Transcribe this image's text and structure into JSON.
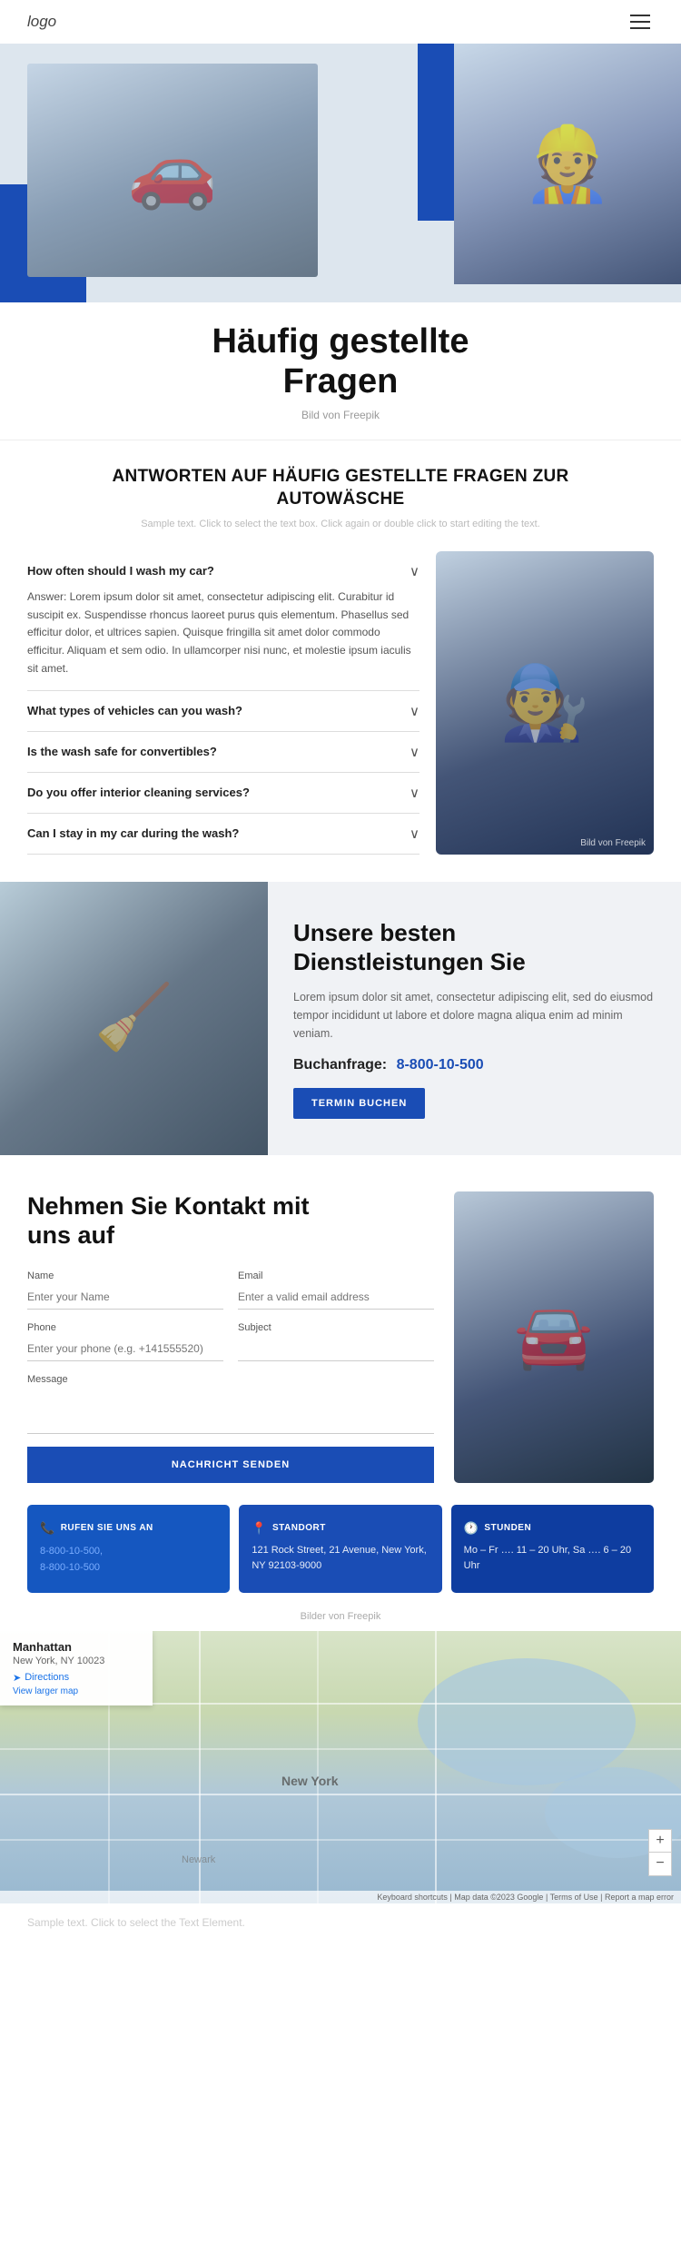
{
  "header": {
    "logo": "logo",
    "menu_icon": "☰"
  },
  "hero": {
    "title_line1": "Häufig gestellte",
    "title_line2": "Fragen",
    "credit": "Bild von Freepik"
  },
  "faq_section": {
    "title": "ANTWORTEN AUF HÄUFIG GESTELLTE FRAGEN ZUR AUTOWÄSCHE",
    "subtitle": "Sample text. Click to select the text box. Click again or double click to start editing the text.",
    "items": [
      {
        "question": "How often should I wash my car?",
        "answer": "Answer: Lorem ipsum dolor sit amet, consectetur adipiscing elit. Curabitur id suscipit ex. Suspendisse rhoncus laoreet purus quis elementum. Phasellus sed efficitur dolor, et ultrices sapien. Quisque fringilla sit amet dolor commodo efficitur. Aliquam et sem odio. In ullamcorper nisi nunc, et molestie ipsum iaculis sit amet.",
        "expanded": true
      },
      {
        "question": "What types of vehicles can you wash?",
        "answer": "",
        "expanded": false
      },
      {
        "question": "Is the wash safe for convertibles?",
        "answer": "",
        "expanded": false
      },
      {
        "question": "Do you offer interior cleaning services?",
        "answer": "",
        "expanded": false
      },
      {
        "question": "Can I stay in my car during the wash?",
        "answer": "",
        "expanded": false
      }
    ],
    "image_credit": "Bild von Freepik"
  },
  "services": {
    "title_line1": "Unsere besten",
    "title_line2": "Dienstleistungen Sie",
    "description": "Lorem ipsum dolor sit amet, consectetur adipiscing elit, sed do eiusmod tempor incididunt ut labore et dolore magna aliqua enim ad minim veniam.",
    "phone_label": "Buchanfrage:",
    "phone_number": "8-800-10-500",
    "button_label": "TERMIN BUCHEN"
  },
  "contact": {
    "title_line1": "Nehmen Sie Kontakt mit",
    "title_line2": "uns auf",
    "form": {
      "name_label": "Name",
      "name_placeholder": "Enter your Name",
      "email_label": "Email",
      "email_placeholder": "Enter a valid email address",
      "phone_label": "Phone",
      "phone_placeholder": "Enter your phone (e.g. +141555520)",
      "subject_label": "Subject",
      "subject_placeholder": "",
      "message_label": "Message",
      "message_placeholder": "",
      "submit_label": "NACHRICHT SENDEN"
    }
  },
  "info_cards": [
    {
      "icon": "📞",
      "title": "RUFEN SIE UNS AN",
      "lines": [
        "8-800-10-500,",
        "8-800-10-500"
      ]
    },
    {
      "icon": "📍",
      "title": "STANDORT",
      "lines": [
        "121 Rock Street, 21 Avenue, New York, NY 92103-9000"
      ]
    },
    {
      "icon": "🕐",
      "title": "STUNDEN",
      "lines": [
        "Mo – Fr …. 11 – 20 Uhr, Sa …. 6 – 20 Uhr"
      ]
    }
  ],
  "freepik_credit": "Bilder von Freepik",
  "map": {
    "title": "Manhattan",
    "subtitle": "New York, NY 10023",
    "directions_label": "Directions",
    "view_larger": "View larger map",
    "zoom_in": "+",
    "zoom_out": "−",
    "credit": "Keyboard shortcuts | Map data ©2023 Google | Terms of Use | Report a map error"
  },
  "bottom_text": "Sample text. Click to select the Text Element."
}
